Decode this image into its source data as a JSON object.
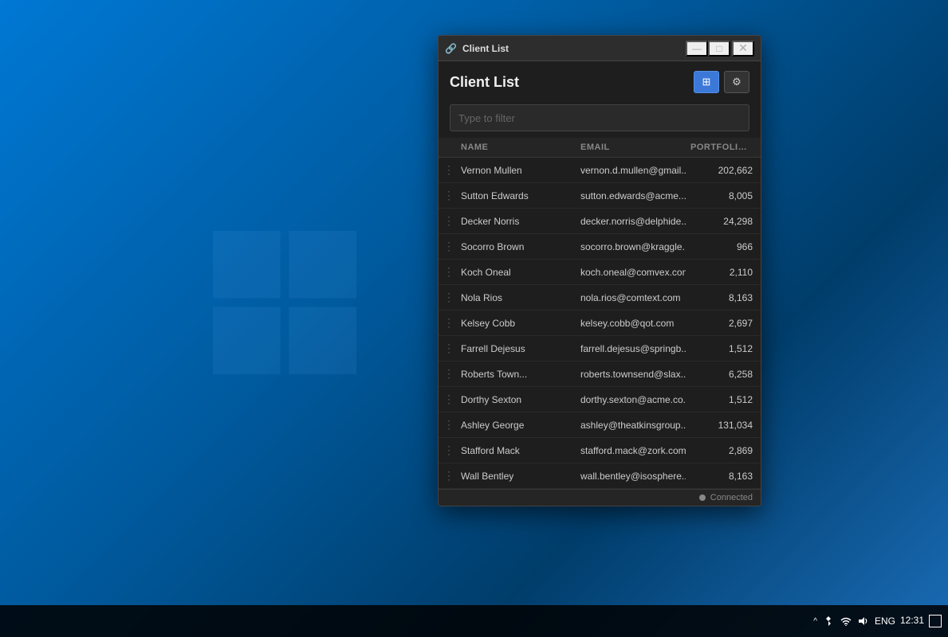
{
  "desktop": {
    "background_color": "#0078d4"
  },
  "taskbar": {
    "time": "12:31",
    "lang": "ENG",
    "chevron_label": "^",
    "notif_icon": "□"
  },
  "window": {
    "title": "Client List",
    "title_icon": "🔗",
    "min_icon": "—",
    "max_icon": "□",
    "close_icon": "✕",
    "header": {
      "title": "Client List",
      "grid_btn_icon": "⊞",
      "settings_btn_icon": "⚙"
    },
    "filter": {
      "placeholder": "Type to filter"
    },
    "table": {
      "columns": [
        "",
        "NAME",
        "EMAIL",
        "PORTFOLIO ..."
      ],
      "rows": [
        {
          "menu": "⋮",
          "name": "Vernon Mullen",
          "email": "vernon.d.mullen@gmail...",
          "portfolio": "202,662"
        },
        {
          "menu": "⋮",
          "name": "Sutton Edwards",
          "email": "sutton.edwards@acme....",
          "portfolio": "8,005"
        },
        {
          "menu": "⋮",
          "name": "Decker Norris",
          "email": "decker.norris@delphide...",
          "portfolio": "24,298"
        },
        {
          "menu": "⋮",
          "name": "Socorro Brown",
          "email": "socorro.brown@kraggle...",
          "portfolio": "966"
        },
        {
          "menu": "⋮",
          "name": "Koch Oneal",
          "email": "koch.oneal@comvex.com",
          "portfolio": "2,110"
        },
        {
          "menu": "⋮",
          "name": "Nola Rios",
          "email": "nola.rios@comtext.com",
          "portfolio": "8,163"
        },
        {
          "menu": "⋮",
          "name": "Kelsey Cobb",
          "email": "kelsey.cobb@qot.com",
          "portfolio": "2,697"
        },
        {
          "menu": "⋮",
          "name": "Farrell Dejesus",
          "email": "farrell.dejesus@springb...",
          "portfolio": "1,512"
        },
        {
          "menu": "⋮",
          "name": "Roberts Town...",
          "email": "roberts.townsend@slax...",
          "portfolio": "6,258"
        },
        {
          "menu": "⋮",
          "name": "Dorthy Sexton",
          "email": "dorthy.sexton@acme.co...",
          "portfolio": "1,512"
        },
        {
          "menu": "⋮",
          "name": "Ashley George",
          "email": "ashley@theatkinsgroup....",
          "portfolio": "131,034"
        },
        {
          "menu": "⋮",
          "name": "Stafford Mack",
          "email": "stafford.mack@zork.com",
          "portfolio": "2,869"
        },
        {
          "menu": "⋮",
          "name": "Wall Bentley",
          "email": "wall.bentley@isosphere...",
          "portfolio": "8,163"
        }
      ]
    },
    "status": {
      "dot_color": "#888888",
      "text": "Connected"
    }
  }
}
